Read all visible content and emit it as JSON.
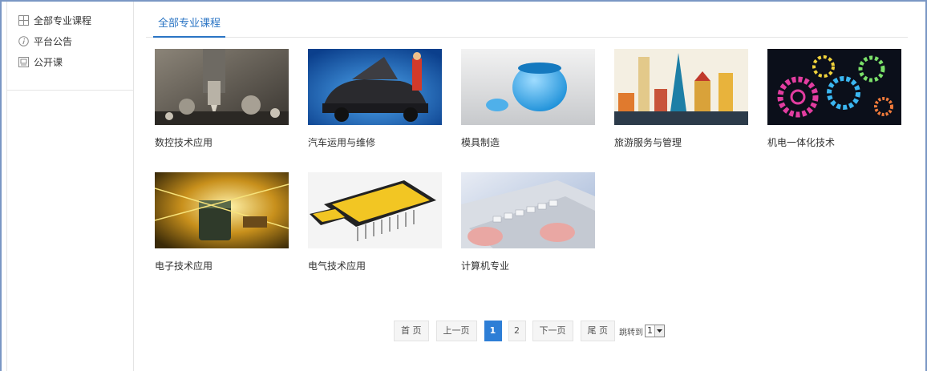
{
  "sidebar": {
    "items": [
      {
        "label": "全部专业课程",
        "icon": "grid-icon"
      },
      {
        "label": "平台公告",
        "icon": "info-circle-icon"
      },
      {
        "label": "公开课",
        "icon": "screen-icon"
      }
    ]
  },
  "main": {
    "tabs": [
      {
        "label": "全部专业课程",
        "active": true
      }
    ],
    "courses": [
      {
        "name": "数控技术应用",
        "image": "cnc-machining-photo"
      },
      {
        "name": "汽车运用与维修",
        "image": "car-mechanic-photo"
      },
      {
        "name": "模具制造",
        "image": "3d-mold-render"
      },
      {
        "name": "旅游服务与管理",
        "image": "landmarks-illustration"
      },
      {
        "name": "机电一体化技术",
        "image": "neon-gears-illustration"
      },
      {
        "name": "电子技术应用",
        "image": "circuit-board-photo"
      },
      {
        "name": "电气技术应用",
        "image": "ic-chip-render"
      },
      {
        "name": "计算机专业",
        "image": "typing-keyboard-photo"
      }
    ]
  },
  "pagination": {
    "first": "首 页",
    "prev": "上一页",
    "pages": [
      "1",
      "2"
    ],
    "current_page": "1",
    "next": "下一页",
    "last": "尾 页",
    "jump_label": "跳转到",
    "jump_value": "1"
  },
  "colors": {
    "accent": "#2a74c4",
    "frame_border": "#7a97c4",
    "active_page": "#2d7ed6"
  }
}
